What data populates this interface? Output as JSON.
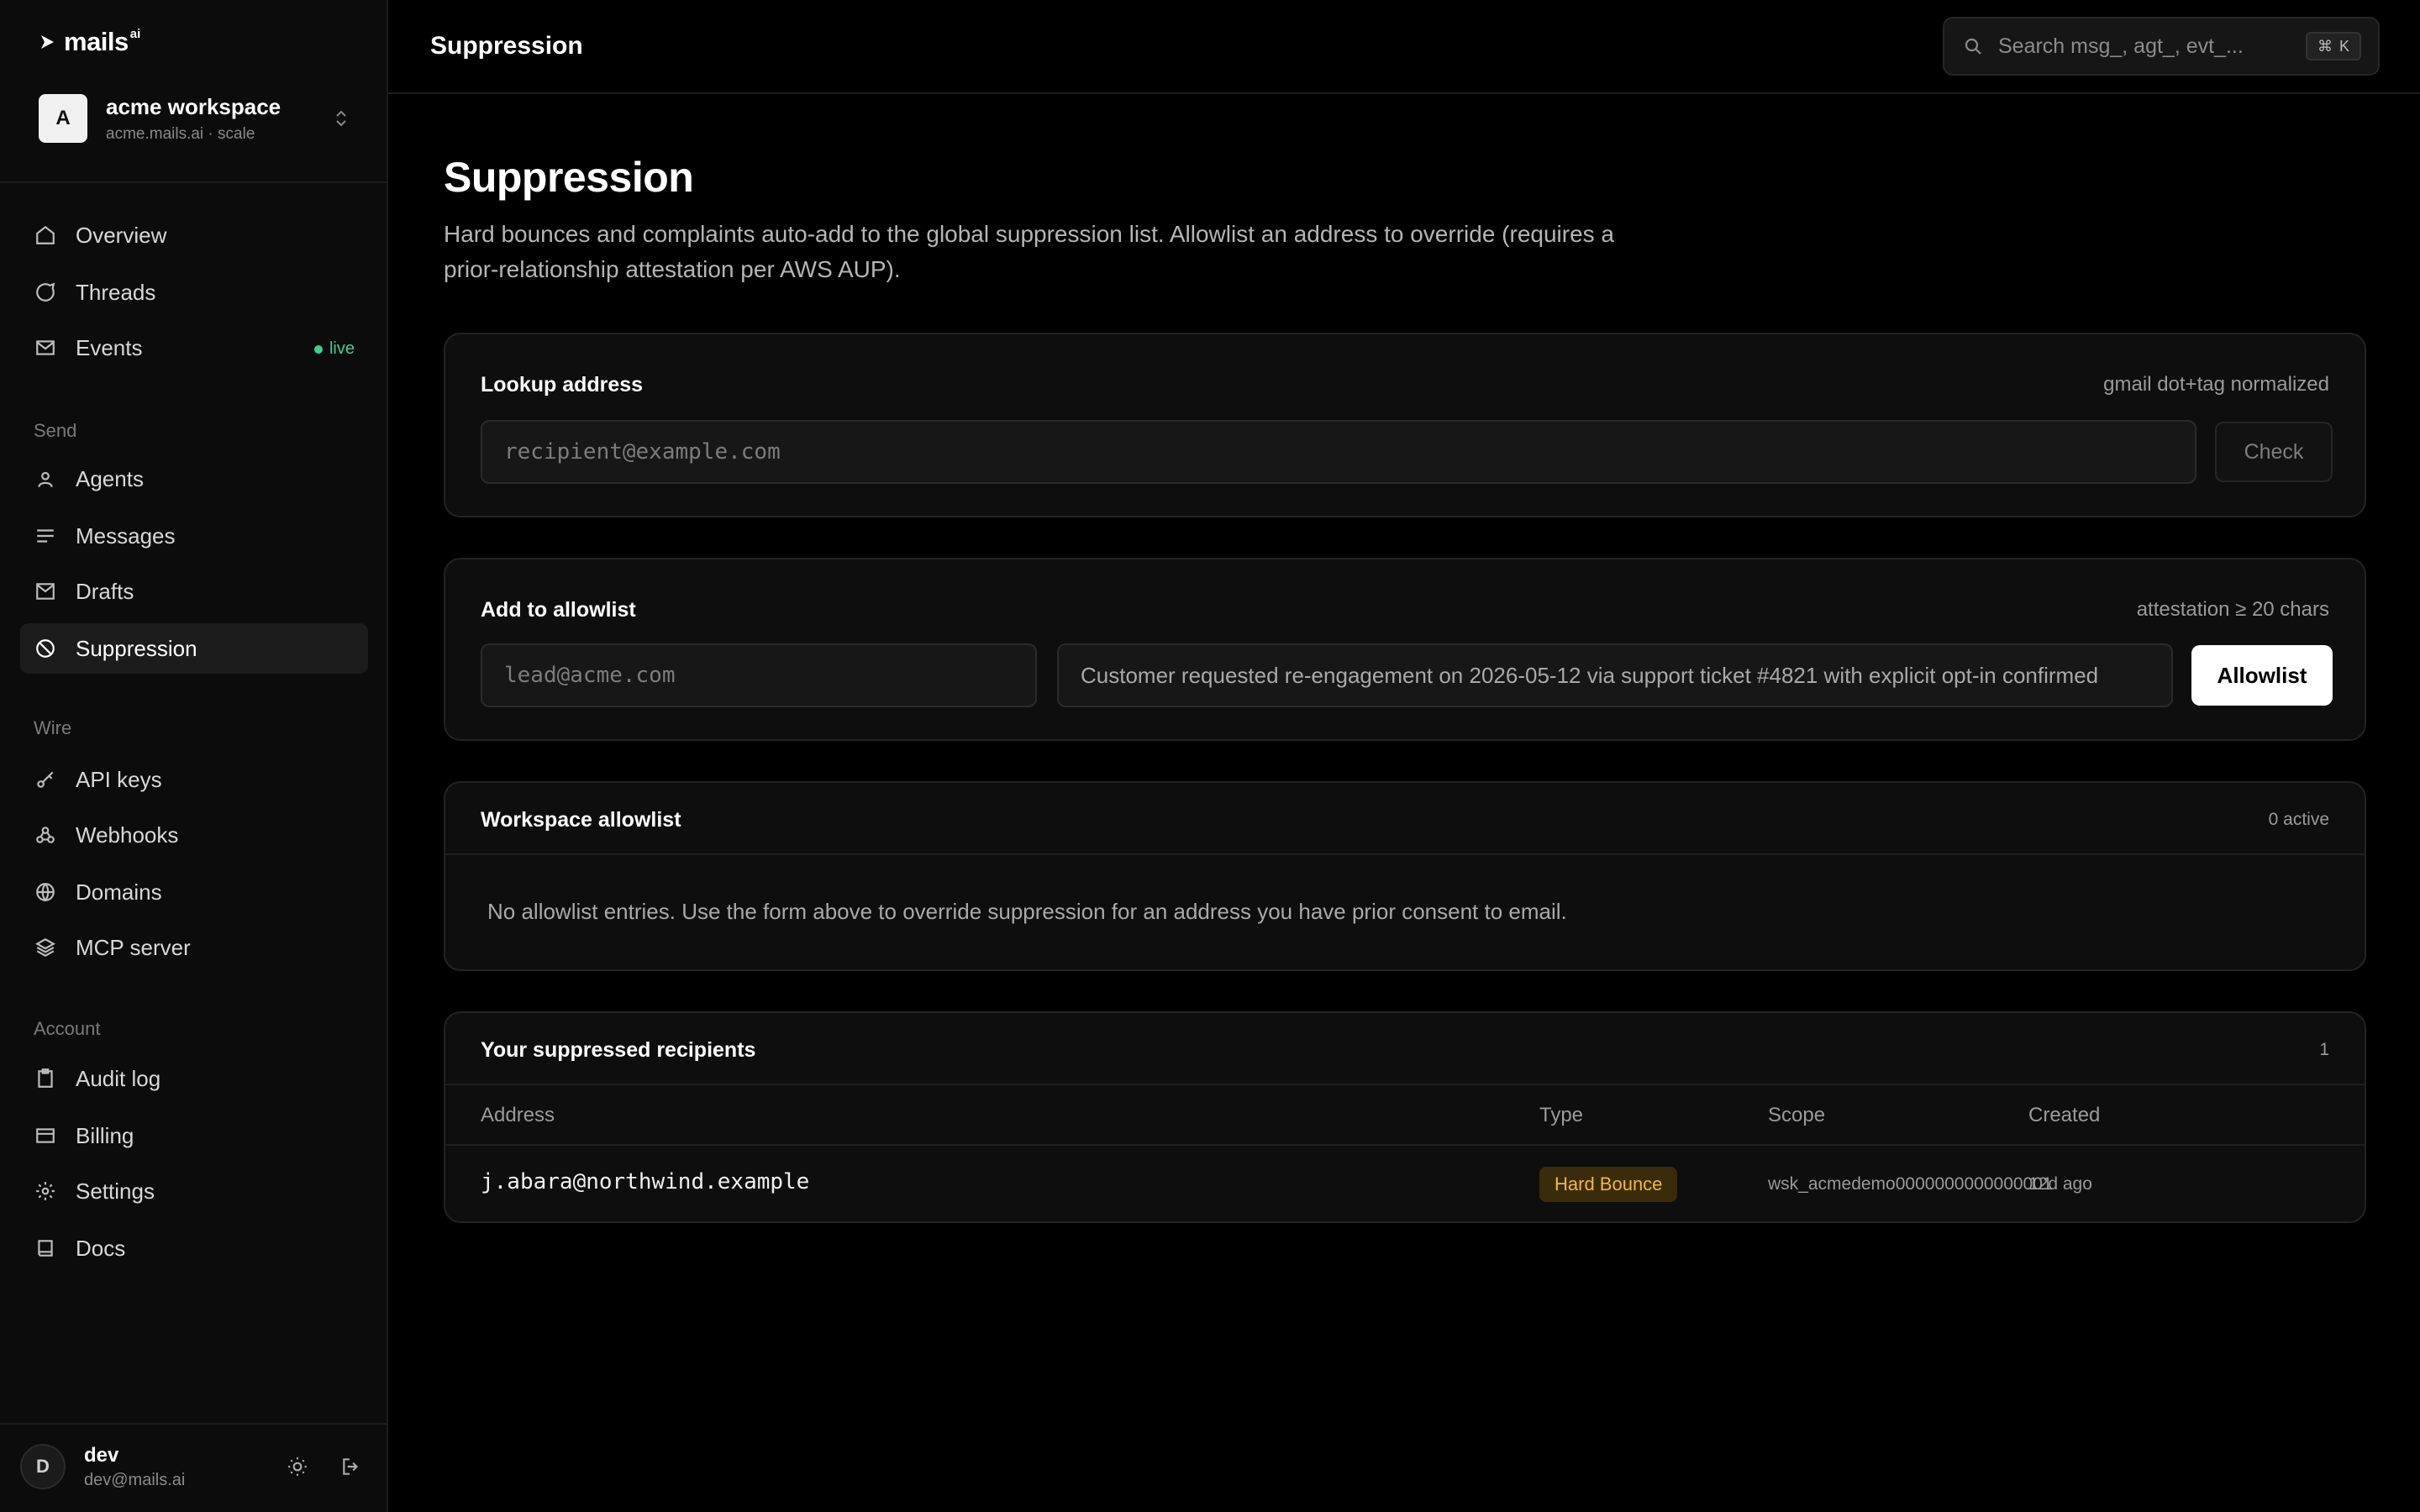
{
  "brand": {
    "name": "mails",
    "superscript": "ai"
  },
  "workspace": {
    "initial": "A",
    "name": "acme workspace",
    "subtitle": "acme.mails.ai · scale"
  },
  "nav": {
    "main": [
      {
        "label": "Overview",
        "icon": "home-icon"
      },
      {
        "label": "Threads",
        "icon": "chat-bubble-icon"
      },
      {
        "label": "Events",
        "icon": "mail-icon",
        "badge": "live"
      }
    ],
    "send_label": "Send",
    "send": [
      {
        "label": "Agents",
        "icon": "person-icon"
      },
      {
        "label": "Messages",
        "icon": "lines-icon"
      },
      {
        "label": "Drafts",
        "icon": "draft-mail-icon"
      },
      {
        "label": "Suppression",
        "icon": "ban-icon",
        "active": true
      }
    ],
    "wire_label": "Wire",
    "wire": [
      {
        "label": "API keys",
        "icon": "key-icon"
      },
      {
        "label": "Webhooks",
        "icon": "webhook-icon"
      },
      {
        "label": "Domains",
        "icon": "globe-icon"
      },
      {
        "label": "MCP server",
        "icon": "layers-icon"
      }
    ],
    "account_label": "Account",
    "account": [
      {
        "label": "Audit log",
        "icon": "clipboard-icon"
      },
      {
        "label": "Billing",
        "icon": "card-icon"
      },
      {
        "label": "Settings",
        "icon": "gear-icon"
      },
      {
        "label": "Docs",
        "icon": "book-icon"
      }
    ]
  },
  "user": {
    "initial": "D",
    "name": "dev",
    "email": "dev@mails.ai"
  },
  "topbar": {
    "title": "Suppression",
    "search_placeholder": "Search msg_, agt_, evt_...",
    "shortcut_symbol": "⌘",
    "shortcut_key": "K"
  },
  "page": {
    "title": "Suppression",
    "description": "Hard bounces and complaints auto-add to the global suppression list. Allowlist an address to override (requires a prior-relationship attestation per AWS AUP)."
  },
  "lookup": {
    "title": "Lookup address",
    "meta": "gmail dot+tag normalized",
    "placeholder": "recipient@example.com",
    "button": "Check"
  },
  "allowlist_form": {
    "title": "Add to allowlist",
    "meta": "attestation ≥ 20 chars",
    "email_placeholder": "lead@acme.com",
    "attestation_value": "Customer requested re-engagement on 2026-05-12 via support ticket #4821 with explicit opt-in confirmed",
    "button": "Allowlist"
  },
  "workspace_allowlist": {
    "title": "Workspace allowlist",
    "meta": "0 active",
    "empty": "No allowlist entries. Use the form above to override suppression for an address you have prior consent to email."
  },
  "suppressed": {
    "title": "Your suppressed recipients",
    "count": "1",
    "columns": [
      "Address",
      "Type",
      "Scope",
      "Created"
    ],
    "rows": [
      {
        "address": "j.abara@northwind.example",
        "type": "Hard Bounce",
        "scope": "wsk_acmedemo0000000000000001",
        "created": "12d ago"
      }
    ]
  },
  "colors": {
    "accent_live": "#3ecf8e",
    "badge_hard_bounce_bg": "#3a2c0a",
    "badge_hard_bounce_fg": "#f3b73c"
  }
}
